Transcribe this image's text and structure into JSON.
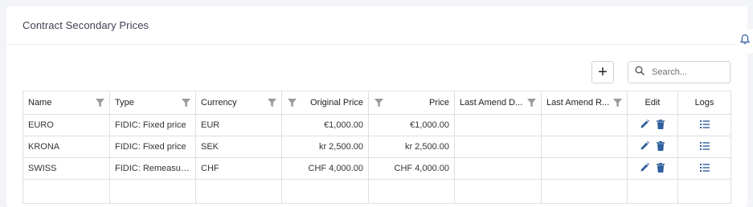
{
  "card": {
    "title": "Contract Secondary Prices"
  },
  "toolbar": {
    "add_label": "+",
    "search_placeholder": "Search..."
  },
  "columns": [
    {
      "label": "Name"
    },
    {
      "label": "Type"
    },
    {
      "label": "Currency"
    },
    {
      "label": "Original Price"
    },
    {
      "label": "Price"
    },
    {
      "label": "Last Amend D..."
    },
    {
      "label": "Last Amend R..."
    },
    {
      "label": "Edit"
    },
    {
      "label": "Logs"
    }
  ],
  "rows": [
    {
      "name": "EURO",
      "type": "FIDIC: Fixed price",
      "currency": "EUR",
      "original_price": "€1,000.00",
      "price": "€1,000.00",
      "last_amend_date": "",
      "last_amend_reason": ""
    },
    {
      "name": "KRONA",
      "type": "FIDIC: Fixed price",
      "currency": "SEK",
      "original_price": "kr 2,500.00",
      "price": "kr 2,500.00",
      "last_amend_date": "",
      "last_amend_reason": ""
    },
    {
      "name": "SWISS",
      "type": "FIDIC: Remeasure...",
      "currency": "CHF",
      "original_price": "CHF 4,000.00",
      "price": "CHF 4,000.00",
      "last_amend_date": "",
      "last_amend_reason": ""
    }
  ],
  "icons": {
    "filter": "filter-icon",
    "edit": "pencil-icon",
    "delete": "trash-icon",
    "logs": "list-icon",
    "search": "search-icon",
    "side_tab": "bell-icon"
  },
  "colors": {
    "accent": "#2f5f9e",
    "filter": "#9a9a9a",
    "border": "#dcdfe4"
  }
}
